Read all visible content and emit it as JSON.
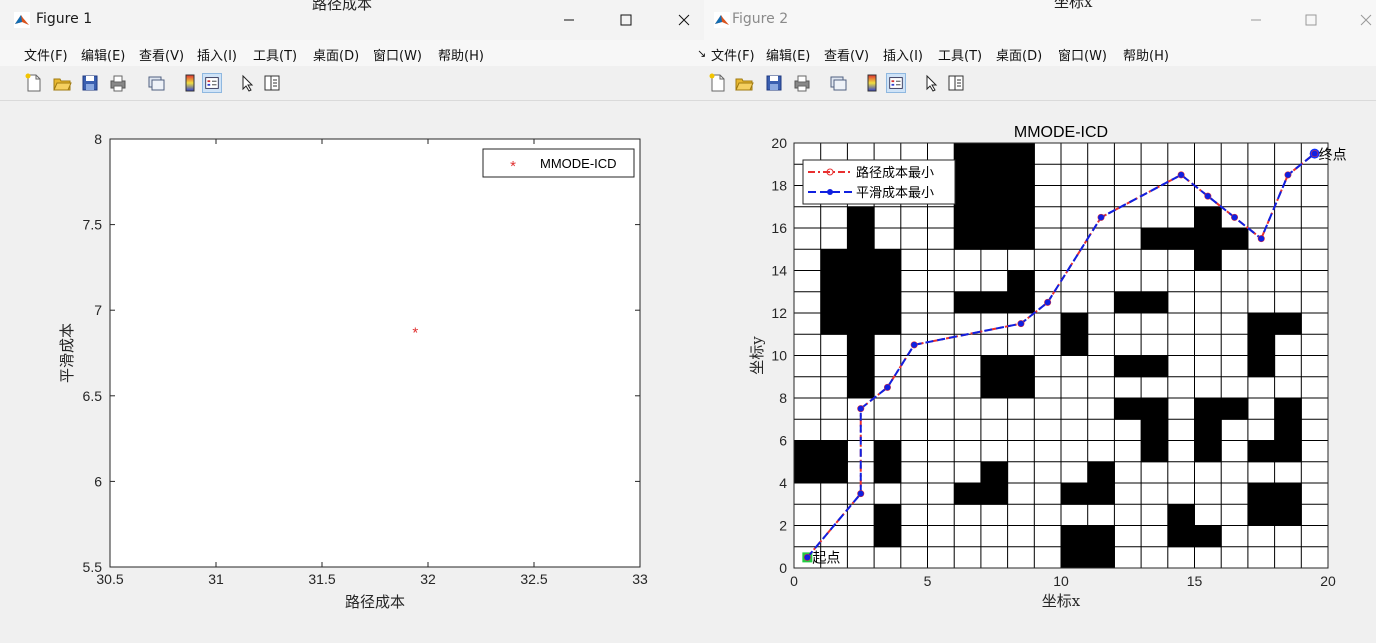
{
  "behind_text": {
    "fig1_title_overflow": "路径成本",
    "fig2_xlabel_overflow": "坐标x"
  },
  "figure1": {
    "title": "Figure 1",
    "menus": [
      "文件(F)",
      "编辑(E)",
      "查看(V)",
      "插入(I)",
      "工具(T)",
      "桌面(D)",
      "窗口(W)",
      "帮助(H)"
    ]
  },
  "figure2": {
    "title": "Figure 2",
    "menus": [
      "文件(F)",
      "编辑(E)",
      "查看(V)",
      "插入(I)",
      "工具(T)",
      "桌面(D)",
      "窗口(W)",
      "帮助(H)"
    ]
  },
  "toolbar_icons": [
    "new-figure-icon",
    "open-file-icon",
    "save-icon",
    "print-icon",
    "link-icon",
    "colorbar-icon",
    "legend-icon",
    "pointer-icon",
    "property-editor-icon"
  ],
  "chart_data": [
    {
      "type": "scatter",
      "title": "",
      "xlabel": "路径成本",
      "ylabel": "平滑成本",
      "xlim": [
        30.5,
        33
      ],
      "ylim": [
        5.5,
        8
      ],
      "xticks": [
        "30.5",
        "31",
        "31.5",
        "32",
        "32.5",
        "33"
      ],
      "yticks": [
        "5.5",
        "6",
        "6.5",
        "7",
        "7.5",
        "8"
      ],
      "series": [
        {
          "name": "MMODE-ICD",
          "marker": "*",
          "color": "#e03030",
          "points": [
            [
              31.94,
              6.88
            ]
          ]
        }
      ],
      "legend_position": "top-right",
      "grid": false
    },
    {
      "type": "line",
      "title": "MMODE-ICD",
      "xlabel": "坐标x",
      "ylabel": "坐标y",
      "xlim": [
        0,
        20
      ],
      "ylim": [
        0,
        20
      ],
      "xticks": [
        "0",
        "5",
        "10",
        "15",
        "20"
      ],
      "yticks": [
        "0",
        "2",
        "4",
        "6",
        "8",
        "10",
        "12",
        "14",
        "16",
        "18",
        "20"
      ],
      "grid": true,
      "obstacle_cells": [
        [
          0,
          4
        ],
        [
          1,
          4
        ],
        [
          0,
          5
        ],
        [
          1,
          5
        ],
        [
          2,
          8
        ],
        [
          2,
          9
        ],
        [
          2,
          10
        ],
        [
          2,
          11
        ],
        [
          2,
          12
        ],
        [
          2,
          13
        ],
        [
          2,
          14
        ],
        [
          2,
          15
        ],
        [
          2,
          16
        ],
        [
          1,
          11
        ],
        [
          1,
          12
        ],
        [
          1,
          13
        ],
        [
          1,
          14
        ],
        [
          3,
          11
        ],
        [
          3,
          12
        ],
        [
          3,
          13
        ],
        [
          3,
          14
        ],
        [
          3,
          4
        ],
        [
          3,
          5
        ],
        [
          3,
          1
        ],
        [
          3,
          2
        ],
        [
          6,
          15
        ],
        [
          6,
          16
        ],
        [
          6,
          17
        ],
        [
          6,
          18
        ],
        [
          6,
          19
        ],
        [
          7,
          15
        ],
        [
          7,
          16
        ],
        [
          7,
          17
        ],
        [
          7,
          18
        ],
        [
          7,
          19
        ],
        [
          8,
          15
        ],
        [
          8,
          16
        ],
        [
          8,
          17
        ],
        [
          8,
          18
        ],
        [
          8,
          19
        ],
        [
          6,
          12
        ],
        [
          7,
          12
        ],
        [
          8,
          12
        ],
        [
          8,
          13
        ],
        [
          7,
          8
        ],
        [
          7,
          9
        ],
        [
          8,
          8
        ],
        [
          8,
          9
        ],
        [
          6,
          3
        ],
        [
          7,
          3
        ],
        [
          7,
          4
        ],
        [
          10,
          10
        ],
        [
          10,
          11
        ],
        [
          10,
          3
        ],
        [
          11,
          3
        ],
        [
          11,
          4
        ],
        [
          10,
          0
        ],
        [
          11,
          0
        ],
        [
          10,
          1
        ],
        [
          11,
          1
        ],
        [
          12,
          12
        ],
        [
          13,
          12
        ],
        [
          12,
          9
        ],
        [
          13,
          9
        ],
        [
          12,
          7
        ],
        [
          13,
          7
        ],
        [
          13,
          6
        ],
        [
          13,
          5
        ],
        [
          13,
          15
        ],
        [
          14,
          15
        ],
        [
          15,
          15
        ],
        [
          16,
          15
        ],
        [
          15,
          16
        ],
        [
          15,
          14
        ],
        [
          15,
          5
        ],
        [
          15,
          6
        ],
        [
          15,
          7
        ],
        [
          16,
          7
        ],
        [
          14,
          1
        ],
        [
          14,
          2
        ],
        [
          15,
          1
        ],
        [
          17,
          9
        ],
        [
          17,
          10
        ],
        [
          17,
          11
        ],
        [
          18,
          11
        ],
        [
          18,
          5
        ],
        [
          18,
          6
        ],
        [
          18,
          7
        ],
        [
          17,
          5
        ],
        [
          17,
          2
        ],
        [
          18,
          2
        ],
        [
          17,
          3
        ],
        [
          18,
          3
        ]
      ],
      "start": {
        "label": "起点",
        "x": 0.5,
        "y": 0.5,
        "color": "#22cc44"
      },
      "goal": {
        "label": "终点",
        "x": 19.5,
        "y": 19.5,
        "color": "#1030ff"
      },
      "series": [
        {
          "name": "路径成本最小",
          "style": "dash-dot",
          "marker": "o",
          "color": "#e83030",
          "points": [
            [
              0.5,
              0.5
            ],
            [
              2.5,
              3.5
            ],
            [
              2.5,
              7.5
            ],
            [
              3.5,
              8.5
            ],
            [
              4.5,
              10.5
            ],
            [
              8.5,
              11.5
            ],
            [
              9.5,
              12.5
            ],
            [
              11.5,
              16.5
            ],
            [
              14.5,
              18.5
            ],
            [
              15.5,
              17.5
            ],
            [
              16.5,
              16.5
            ],
            [
              17.5,
              15.5
            ],
            [
              18.5,
              18.5
            ],
            [
              19.5,
              19.5
            ]
          ]
        },
        {
          "name": "平滑成本最小",
          "style": "dashed",
          "marker": ".",
          "color": "#1020e0",
          "points": [
            [
              0.5,
              0.5
            ],
            [
              2.5,
              3.5
            ],
            [
              2.5,
              7.5
            ],
            [
              3.5,
              8.5
            ],
            [
              4.5,
              10.5
            ],
            [
              8.5,
              11.5
            ],
            [
              9.5,
              12.5
            ],
            [
              11.5,
              16.5
            ],
            [
              14.5,
              18.5
            ],
            [
              15.5,
              17.5
            ],
            [
              16.5,
              16.5
            ],
            [
              17.5,
              15.5
            ],
            [
              18.5,
              18.5
            ],
            [
              19.5,
              19.5
            ]
          ]
        }
      ],
      "legend_position": "top-left"
    }
  ]
}
